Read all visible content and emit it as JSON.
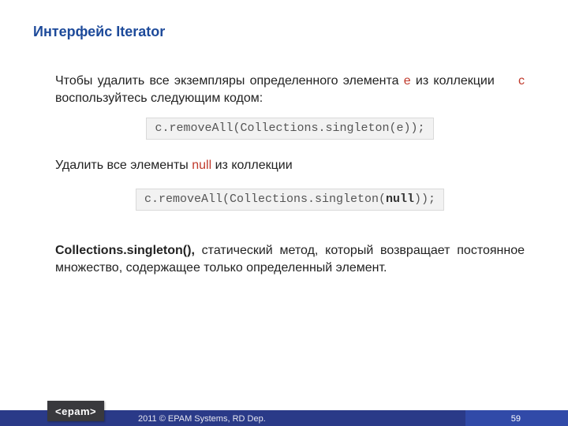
{
  "title": "Интерфейс Iterator",
  "para1_a": "Чтобы удалить все экземпляры определенного элемента ",
  "para1_e": "e",
  "para1_b": " из коллекции ",
  "para1_c": "c",
  "para1_d": " воспользуйтесь следующим кодом:",
  "code1": "c.removeAll(Collections.singleton(e));",
  "para2_a": "Удалить все элементы ",
  "para2_null": "null",
  "para2_b": " из коллекции",
  "code2_a": "c.removeAll(Collections.singleton(",
  "code2_kw": "null",
  "code2_b": "));",
  "para3_bold": "Collections.singleton(),",
  "para3_rest": " статический метод, который возвращает постоянное множество, содержащее только определенный элемент.",
  "logo": "<epam>",
  "copyright": "2011 © EPAM Systems, RD Dep.",
  "page": "59"
}
